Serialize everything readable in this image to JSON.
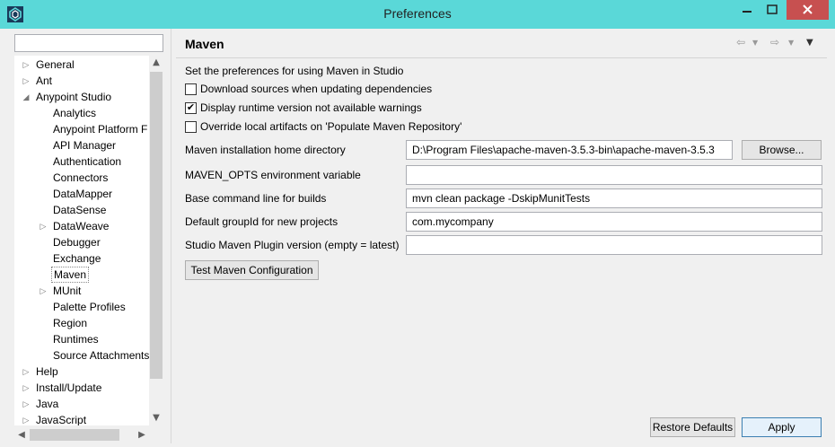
{
  "window": {
    "title": "Preferences"
  },
  "tree": {
    "filter_value": "",
    "items": [
      {
        "label": "General",
        "level": 0,
        "expandable": true,
        "expanded": false
      },
      {
        "label": "Ant",
        "level": 0,
        "expandable": true,
        "expanded": false
      },
      {
        "label": "Anypoint Studio",
        "level": 0,
        "expandable": true,
        "expanded": true
      },
      {
        "label": "Analytics",
        "level": 1,
        "expandable": false
      },
      {
        "label": "Anypoint Platform F",
        "level": 1,
        "expandable": false
      },
      {
        "label": "API Manager",
        "level": 1,
        "expandable": false
      },
      {
        "label": "Authentication",
        "level": 1,
        "expandable": false
      },
      {
        "label": "Connectors",
        "level": 1,
        "expandable": false
      },
      {
        "label": "DataMapper",
        "level": 1,
        "expandable": false
      },
      {
        "label": "DataSense",
        "level": 1,
        "expandable": false
      },
      {
        "label": "DataWeave",
        "level": 1,
        "expandable": true,
        "expanded": false
      },
      {
        "label": "Debugger",
        "level": 1,
        "expandable": false
      },
      {
        "label": "Exchange",
        "level": 1,
        "expandable": false
      },
      {
        "label": "Maven",
        "level": 1,
        "expandable": false,
        "selected": true
      },
      {
        "label": "MUnit",
        "level": 1,
        "expandable": true,
        "expanded": false
      },
      {
        "label": "Palette Profiles",
        "level": 1,
        "expandable": false
      },
      {
        "label": "Region",
        "level": 1,
        "expandable": false
      },
      {
        "label": "Runtimes",
        "level": 1,
        "expandable": false
      },
      {
        "label": "Source Attachments",
        "level": 1,
        "expandable": false
      },
      {
        "label": "Help",
        "level": 0,
        "expandable": true,
        "expanded": false
      },
      {
        "label": "Install/Update",
        "level": 0,
        "expandable": true,
        "expanded": false
      },
      {
        "label": "Java",
        "level": 0,
        "expandable": true,
        "expanded": false
      },
      {
        "label": "JavaScript",
        "level": 0,
        "expandable": true,
        "expanded": false
      }
    ]
  },
  "page": {
    "title": "Maven",
    "description": "Set the preferences for using Maven in Studio",
    "checkboxes": [
      {
        "label": "Download sources when updating dependencies",
        "checked": false
      },
      {
        "label": "Display runtime version not available warnings",
        "checked": true
      },
      {
        "label": "Override local artifacts on 'Populate Maven Repository'",
        "checked": false
      }
    ],
    "fields": [
      {
        "label": "Maven installation home directory",
        "value": "D:\\Program Files\\apache-maven-3.5.3-bin\\apache-maven-3.5.3"
      },
      {
        "label": "MAVEN_OPTS environment variable",
        "value": ""
      },
      {
        "label": "Base command line for builds",
        "value": "mvn clean package -DskipMunitTests"
      },
      {
        "label": "Default groupId for new projects",
        "value": "com.mycompany"
      },
      {
        "label": "Studio Maven Plugin version (empty = latest)",
        "value": ""
      }
    ],
    "browse_label": "Browse...",
    "test_label": "Test Maven Configuration"
  },
  "footer": {
    "restore_label": "Restore Defaults",
    "apply_label": "Apply"
  },
  "colors": {
    "titlebar": "#5ad8d8",
    "close_button": "#c75050"
  },
  "icons": {
    "app": "studio-logo-icon",
    "back": "back-arrow-icon",
    "forward": "forward-arrow-icon",
    "menu": "view-menu-icon"
  }
}
